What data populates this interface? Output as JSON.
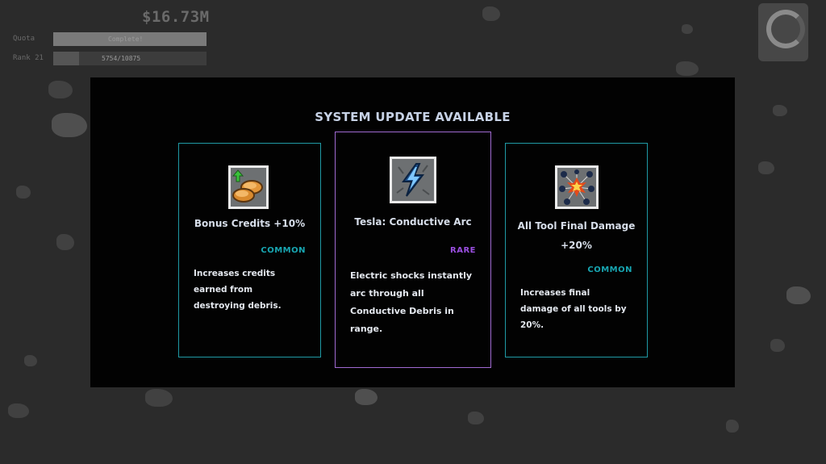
{
  "hud": {
    "money": "$16.73M",
    "quota_label": "Quota",
    "quota_status": "Complete!",
    "rank_label": "Rank 21",
    "rank_progress": "5754/10875"
  },
  "modal": {
    "title": "SYSTEM UPDATE AVAILABLE",
    "cards": [
      {
        "title": "Bonus Credits +10%",
        "rarity": "COMMON",
        "description": "Increases credits earned from destroying debris.",
        "icon": "bonus-credits-icon"
      },
      {
        "title": "Tesla: Conductive Arc",
        "rarity": "RARE",
        "description": "Electric shocks instantly arc through all Conductive Debris in range.",
        "icon": "lightning-icon"
      },
      {
        "title": "All Tool Final Damage +20%",
        "rarity": "COMMON",
        "description": "Increases final damage of all tools by 20%.",
        "icon": "explosion-icon"
      }
    ]
  },
  "colors": {
    "common": "#18a6b2",
    "rare": "#9a4fe0",
    "common_border": "#1f9aa5",
    "rare_border": "#a06ad2",
    "title_text": "#c7d2e6"
  }
}
